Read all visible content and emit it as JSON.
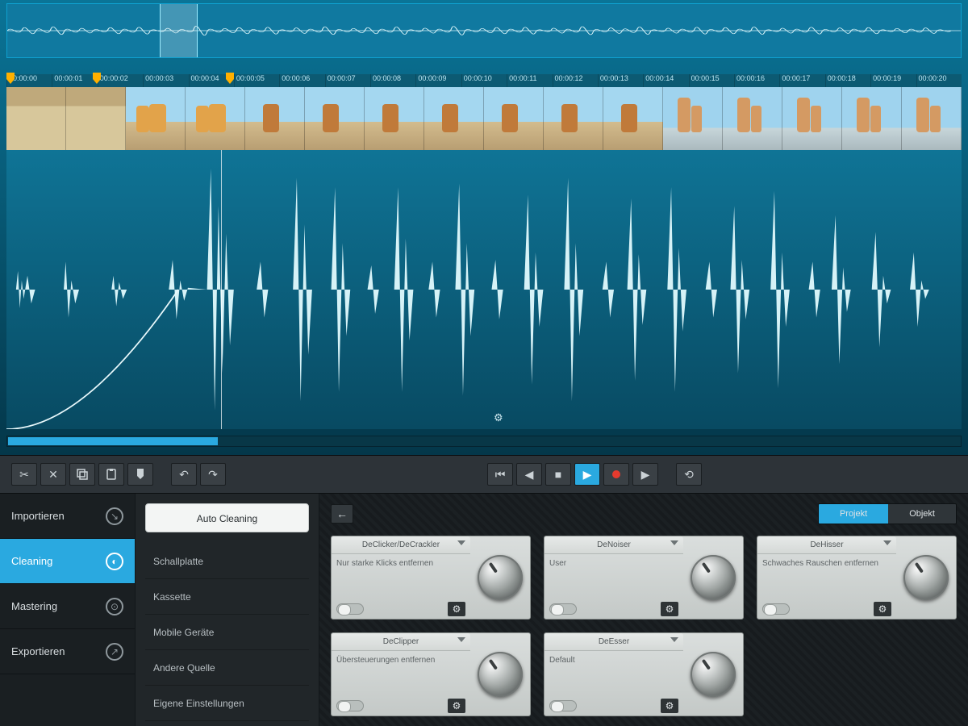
{
  "ruler": {
    "ticks": [
      "00:00:00",
      "00:00:01",
      "00:00:02",
      "00:00:03",
      "00:00:04",
      "00:00:05",
      "00:00:06",
      "00:00:07",
      "00:00:08",
      "00:00:09",
      "00:00:10",
      "00:00:11",
      "00:00:12",
      "00:00:13",
      "00:00:14",
      "00:00:15",
      "00:00:16",
      "00:00:17",
      "00:00:18",
      "00:00:19",
      "00:00:20"
    ]
  },
  "toolbar": {
    "cut": "Cut",
    "delete": "Delete",
    "copy": "Copy",
    "paste": "Paste",
    "marker": "Marker",
    "undo": "Undo",
    "redo": "Redo",
    "prev_marker": "Prev marker",
    "step_back": "Step back",
    "stop": "Stop",
    "play": "Play",
    "record": "Record",
    "step_fwd": "Step forward",
    "loop": "Loop"
  },
  "sidebar": {
    "items": [
      {
        "label": "Importieren",
        "icon": "import"
      },
      {
        "label": "Cleaning",
        "icon": "clean"
      },
      {
        "label": "Mastering",
        "icon": "master"
      },
      {
        "label": "Exportieren",
        "icon": "export"
      }
    ],
    "active_index": 1
  },
  "sub": {
    "auto_button": "Auto Cleaning",
    "items": [
      "Schallplatte",
      "Kassette",
      "Mobile Geräte",
      "Andere Quelle",
      "Eigene Einstellungen"
    ]
  },
  "effects_header": {
    "back": "Back",
    "tabs": [
      {
        "label": "Projekt",
        "active": true
      },
      {
        "label": "Objekt",
        "active": false
      }
    ]
  },
  "modules": [
    {
      "title": "DeClicker/DeCrackler",
      "desc": "Nur starke Klicks entfernen"
    },
    {
      "title": "DeNoiser",
      "desc": "User"
    },
    {
      "title": "DeHisser",
      "desc": "Schwaches Rauschen entfernen"
    },
    {
      "title": "DeClipper",
      "desc": "Übersteuerungen entfernen"
    },
    {
      "title": "DeEsser",
      "desc": "Default"
    }
  ]
}
